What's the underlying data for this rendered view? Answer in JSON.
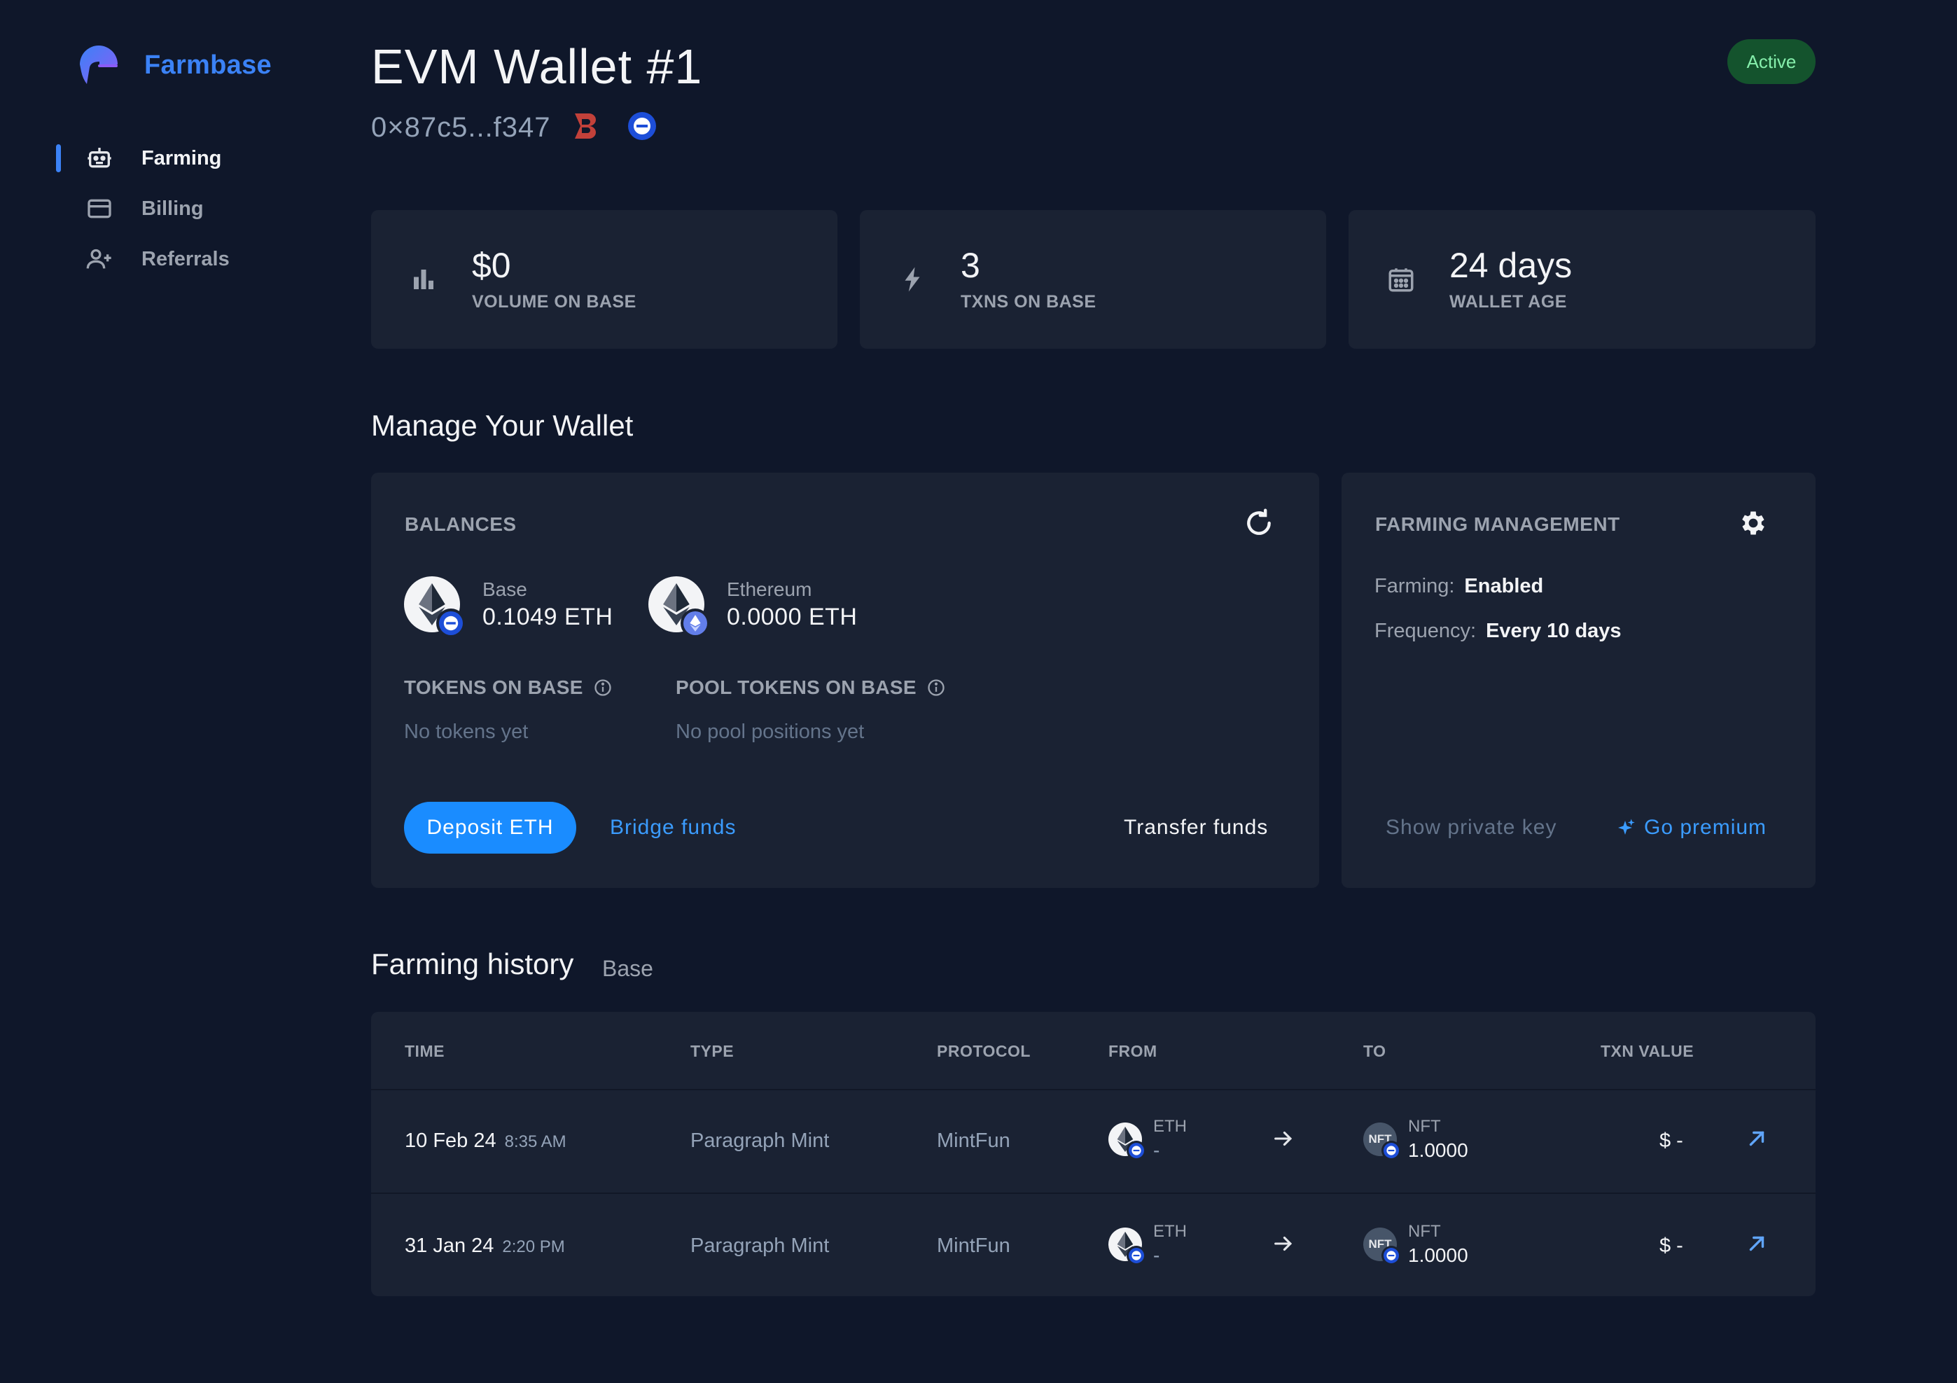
{
  "brand": {
    "name": "Farmbase"
  },
  "nav": {
    "items": [
      {
        "label": "Farming",
        "icon": "robot-icon",
        "active": true
      },
      {
        "label": "Billing",
        "icon": "credit-card-icon",
        "active": false
      },
      {
        "label": "Referrals",
        "icon": "user-plus-icon",
        "active": false
      }
    ]
  },
  "wallet": {
    "title": "EVM Wallet #1",
    "address": "0×87c5...f347",
    "status": "Active"
  },
  "stats": [
    {
      "value": "$0",
      "label": "VOLUME ON BASE",
      "icon": "bar-chart-icon"
    },
    {
      "value": "3",
      "label": "TXNS ON BASE",
      "icon": "lightning-icon"
    },
    {
      "value": "24 days",
      "label": "WALLET AGE",
      "icon": "calendar-icon"
    }
  ],
  "manage": {
    "title": "Manage Your Wallet",
    "balances": {
      "heading": "BALANCES",
      "items": [
        {
          "chain": "Base",
          "amount": "0.1049 ETH"
        },
        {
          "chain": "Ethereum",
          "amount": "0.0000 ETH"
        }
      ],
      "tokens_heading": "TOKENS ON BASE",
      "tokens_empty": "No tokens yet",
      "pool_heading": "POOL TOKENS ON BASE",
      "pool_empty": "No pool positions yet",
      "deposit_label": "Deposit ETH",
      "bridge_label": "Bridge funds",
      "transfer_label": "Transfer funds"
    },
    "farming": {
      "heading": "FARMING MANAGEMENT",
      "farming_key": "Farming:",
      "farming_value": "Enabled",
      "frequency_key": "Frequency:",
      "frequency_value": "Every 10 days",
      "private_key_label": "Show private key",
      "premium_label": "Go premium"
    }
  },
  "history": {
    "title": "Farming history",
    "subtitle": "Base",
    "columns": [
      "TIME",
      "TYPE",
      "PROTOCOL",
      "FROM",
      "TO",
      "TXN VALUE"
    ],
    "rows": [
      {
        "date": "10 Feb 24",
        "time": "8:35 AM",
        "type": "Paragraph Mint",
        "protocol": "MintFun",
        "from_token": "ETH",
        "from_amount": "-",
        "to_icon_text": "NFT",
        "to_token": "NFT",
        "to_amount": "1.0000",
        "value": "$ -"
      },
      {
        "date": "31 Jan 24",
        "time": "2:20 PM",
        "type": "Paragraph Mint",
        "protocol": "MintFun",
        "from_token": "ETH",
        "from_amount": "-",
        "to_icon_text": "NFT",
        "to_token": "NFT",
        "to_amount": "1.0000",
        "value": "$ -"
      }
    ]
  },
  "colors": {
    "accent": "#1a8cff",
    "background": "#0f172a",
    "card": "#1a2233",
    "active_badge": "#14532d",
    "base_blue": "#1d4ed8"
  }
}
